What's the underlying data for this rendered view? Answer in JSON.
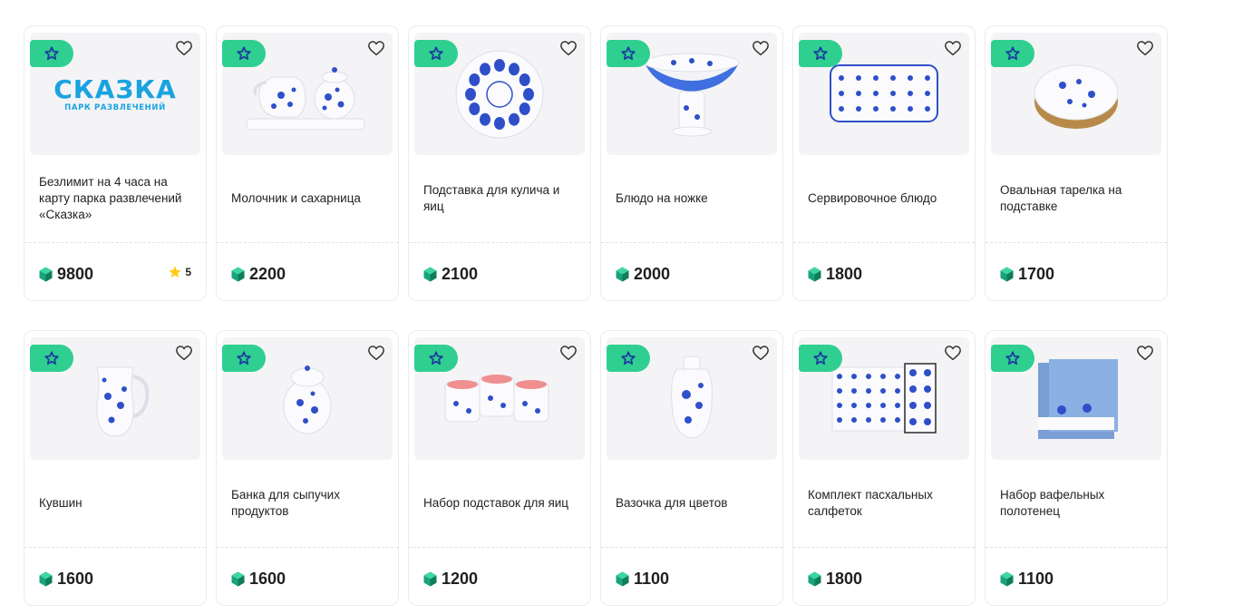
{
  "products": [
    {
      "title": "Безлимит на 4 часа на карту парка развлечений «Сказка»",
      "price": "9800",
      "rating": "5",
      "image": "skazka-logo",
      "logo": {
        "name": "СКАЗКА",
        "tagline": "ПАРК РАЗВЛЕЧЕНИЙ"
      }
    },
    {
      "title": "Молочник и сахарница",
      "price": "2200",
      "image": "creamer-sugar-set"
    },
    {
      "title": "Подставка для кулича и яиц",
      "price": "2100",
      "image": "egg-stand-plate"
    },
    {
      "title": "Блюдо на ножке",
      "price": "2000",
      "image": "footed-bowl"
    },
    {
      "title": "Сервировочное блюдо",
      "price": "1800",
      "image": "serving-tray"
    },
    {
      "title": "Овальная тарелка на подставке",
      "price": "1700",
      "image": "oval-plate"
    },
    {
      "title": "Кувшин",
      "price": "1600",
      "image": "jug"
    },
    {
      "title": "Банка для сыпучих продуктов",
      "price": "1600",
      "image": "storage-jar"
    },
    {
      "title": "Набор подставок для яиц",
      "price": "1200",
      "image": "egg-cups"
    },
    {
      "title": "Вазочка для цветов",
      "price": "1100",
      "image": "small-vase"
    },
    {
      "title": "Комплект пасхальных салфеток",
      "price": "1800",
      "image": "napkin-set"
    },
    {
      "title": "Набор вафельных полотенец",
      "price": "1100",
      "image": "towel-set"
    }
  ],
  "colors": {
    "accent": "#2fcf90",
    "currency": "#1aa37a",
    "star": "#ffcc1a",
    "porcelain_blue": "#2f4fc9"
  },
  "icons": {
    "badge": "star-outline-icon",
    "favorite": "heart-outline-icon",
    "currency": "crystal-icon",
    "rating": "star-filled-icon"
  }
}
